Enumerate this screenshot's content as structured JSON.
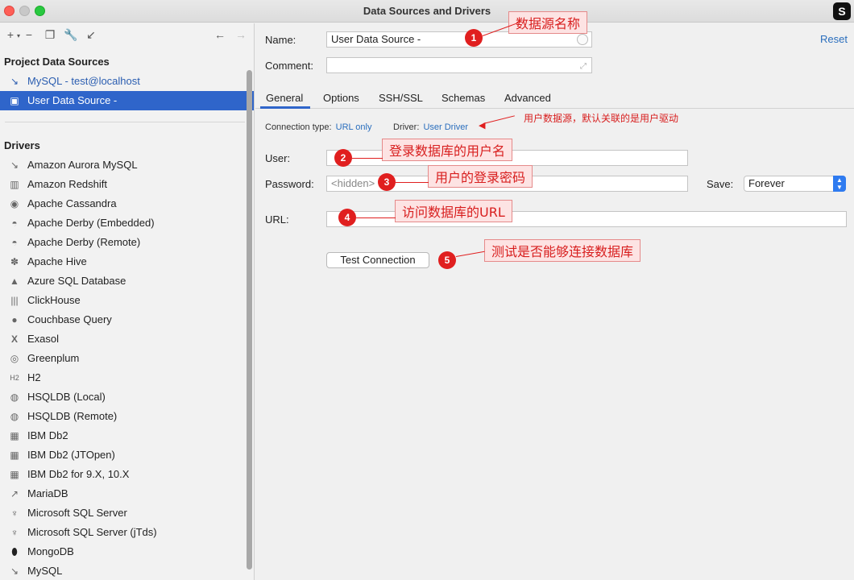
{
  "window": {
    "title": "Data Sources and Drivers",
    "logo": "S"
  },
  "sidebar": {
    "project_title": "Project Data Sources",
    "data_sources": [
      {
        "label": "MySQL - test@localhost",
        "icon": "mysql-dolphin-icon"
      },
      {
        "label": "User Data Source -",
        "icon": "user-datasource-icon"
      }
    ],
    "drivers_title": "Drivers",
    "drivers": [
      "Amazon Aurora MySQL",
      "Amazon Redshift",
      "Apache Cassandra",
      "Apache Derby (Embedded)",
      "Apache Derby (Remote)",
      "Apache Hive",
      "Azure SQL Database",
      "ClickHouse",
      "Couchbase Query",
      "Exasol",
      "Greenplum",
      "H2",
      "HSQLDB (Local)",
      "HSQLDB (Remote)",
      "IBM Db2",
      "IBM Db2 (JTOpen)",
      "IBM Db2 for 9.X, 10.X",
      "MariaDB",
      "Microsoft SQL Server",
      "Microsoft SQL Server (jTds)",
      "MongoDB",
      "MySQL"
    ]
  },
  "form": {
    "name_label": "Name:",
    "name_value": "User Data Source -",
    "comment_label": "Comment:",
    "comment_value": "",
    "reset_label": "Reset",
    "tabs": [
      "General",
      "Options",
      "SSH/SSL",
      "Schemas",
      "Advanced"
    ],
    "connection_type_label": "Connection type:",
    "connection_type_value": "URL only",
    "driver_label": "Driver:",
    "driver_value": "User Driver",
    "user_label": "User:",
    "user_value": "",
    "password_label": "Password:",
    "password_placeholder": "<hidden>",
    "save_label": "Save:",
    "save_value": "Forever",
    "url_label": "URL:",
    "url_value": "",
    "test_button": "Test Connection"
  },
  "annotations": {
    "a1": {
      "num": "1",
      "text": "数据源名称"
    },
    "a2": {
      "num": "2",
      "text": "登录数据库的用户名"
    },
    "a3": {
      "num": "3",
      "text": "用户的登录密码"
    },
    "a4": {
      "num": "4",
      "text": "访问数据库的URL"
    },
    "a5": {
      "num": "5",
      "text": "测试是否能够连接数据库"
    },
    "driver_note": "用户数据源，默认关联的是用户驱动"
  },
  "colors": {
    "accent": "#2f65ca",
    "annotation": "#e01f1f",
    "link": "#2a6ebd"
  }
}
